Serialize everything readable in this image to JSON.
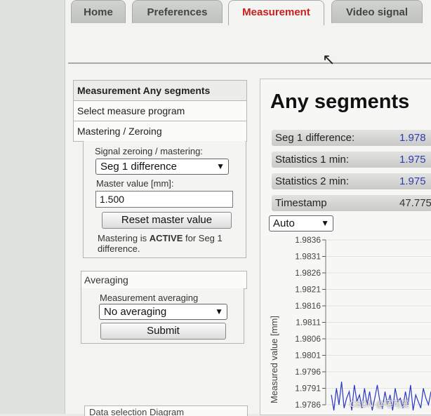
{
  "tabs": [
    "Home",
    "Preferences",
    "Measurement",
    "Video signal"
  ],
  "active_tab": "Measurement",
  "nav": {
    "items": [
      "Measurement Any segments",
      "Select measure program",
      "Mastering / Zeroing"
    ]
  },
  "mastering": {
    "signal_label": "Signal zeroing / mastering:",
    "signal_value": "Seg 1 difference",
    "master_label": "Master value [mm]:",
    "master_value": "1.500",
    "reset_button": "Reset master value",
    "status_prefix": "Mastering is ",
    "status_state": "ACTIVE",
    "status_suffix": " for Seg 1 difference."
  },
  "averaging": {
    "header": "Averaging",
    "label": "Measurement averaging",
    "value": "No averaging",
    "submit": "Submit"
  },
  "data_selection": "Data selection Diagram",
  "main": {
    "title": "Any segments",
    "rows": [
      {
        "key": "Seg 1 difference:",
        "value": "1.978"
      },
      {
        "key": "Statistics 1 min:",
        "value": "1.975"
      },
      {
        "key": "Statistics 2 min:",
        "value": "1.975"
      },
      {
        "key": "Timestamp",
        "value": "47.775"
      }
    ],
    "scale_select": "Auto"
  },
  "chart_data": {
    "type": "line",
    "ylabel": "Measured value [mm]",
    "yticks": [
      "1.9836",
      "1.9831",
      "1.9826",
      "1.9821",
      "1.9816",
      "1.9811",
      "1.9806",
      "1.9801",
      "1.9796",
      "1.9791",
      "1.9786"
    ],
    "ylim": [
      1.9786,
      1.9836
    ],
    "grid": true,
    "series": [
      {
        "values": [
          1.9789,
          1.9784,
          1.9791,
          1.9786,
          1.9793,
          1.9785,
          1.9788,
          1.979,
          1.9783,
          1.9792,
          1.9787,
          1.9789,
          1.9785,
          1.9791,
          1.9786,
          1.979,
          1.9784,
          1.9788,
          1.9792,
          1.9787,
          1.9785,
          1.979,
          1.9786,
          1.9789,
          1.9784,
          1.9791,
          1.9787,
          1.9788,
          1.9785,
          1.979,
          1.9786,
          1.9792,
          1.9784,
          1.9789,
          1.9787,
          1.9785,
          1.9791,
          1.9788,
          1.9786,
          1.979
        ]
      }
    ]
  },
  "watermark": "CSDN @宅可爱",
  "colors": {
    "active_tab": "#c81e1e",
    "value_blue": "#2d3cb0",
    "series": "#2a36c8"
  }
}
